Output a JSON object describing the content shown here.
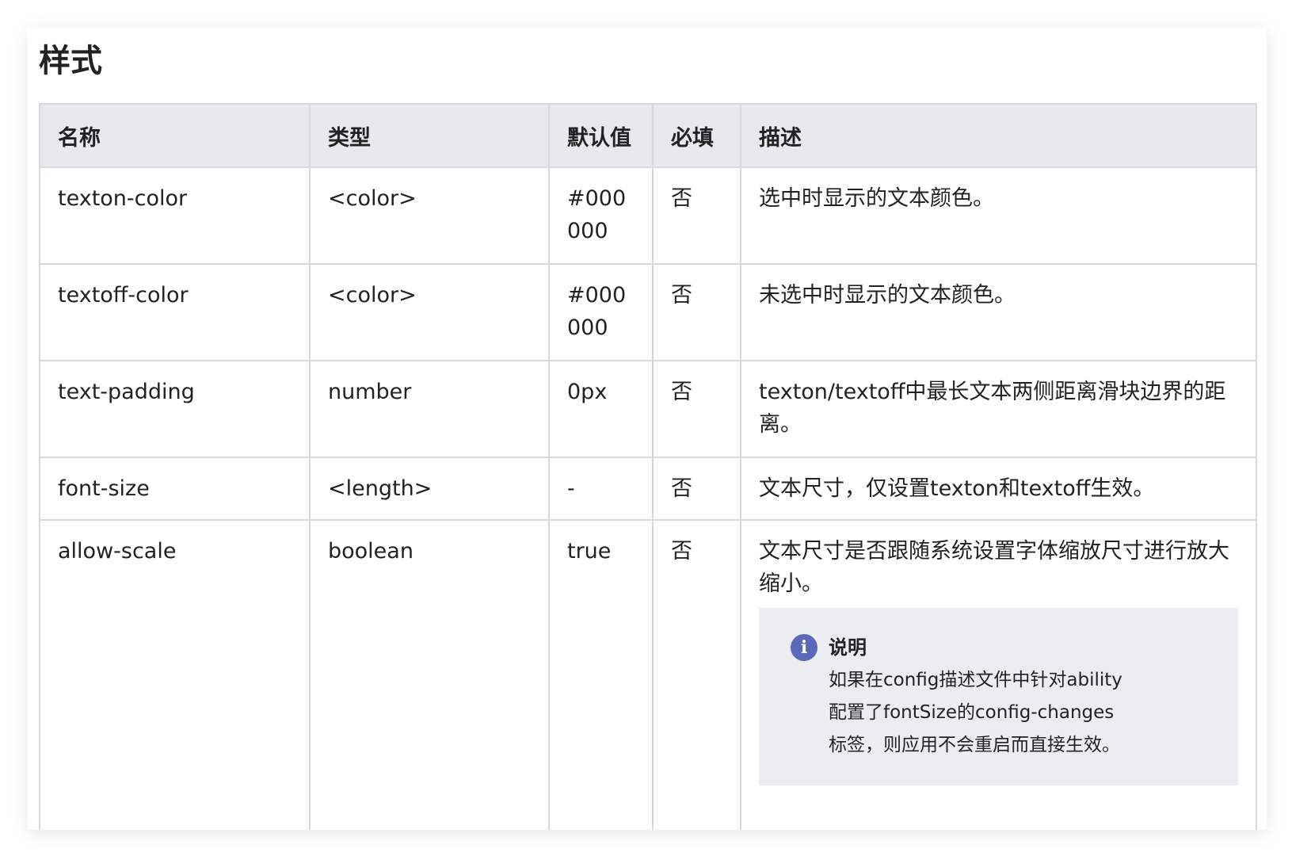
{
  "section": {
    "title": "样式"
  },
  "table": {
    "headers": [
      "名称",
      "类型",
      "默认值",
      "必填",
      "描述"
    ],
    "rows": [
      {
        "name": "texton-color",
        "type": "<color>",
        "default": "#000000",
        "required": "否",
        "description": "选中时显示的文本颜色。"
      },
      {
        "name": "textoff-color",
        "type": "<color>",
        "default": "#000000",
        "required": "否",
        "description": "未选中时显示的文本颜色。"
      },
      {
        "name": "text-padding",
        "type": "number",
        "default": "0px",
        "required": "否",
        "description": "texton/textoff中最长文本两侧距离滑块边界的距离。"
      },
      {
        "name": "font-size",
        "type": "<length>",
        "default": "-",
        "required": "否",
        "description": "文本尺寸，仅设置texton和textoff生效。"
      },
      {
        "name": "allow-scale",
        "type": "boolean",
        "default": "true",
        "required": "否",
        "description": "文本尺寸是否跟随系统设置字体缩放尺寸进行放大缩小。",
        "note": {
          "icon": "info-icon",
          "title": "说明",
          "text": "如果在config描述文件中针对ability配置了fontSize的config-changes标签，则应用不会重启而直接生效。"
        }
      }
    ]
  },
  "colors": {
    "header_bg": "#e6e9ed",
    "border": "#d6d9de",
    "note_bg": "#ebedf1",
    "info_icon": "#5a6ab8",
    "text": "#222222"
  }
}
